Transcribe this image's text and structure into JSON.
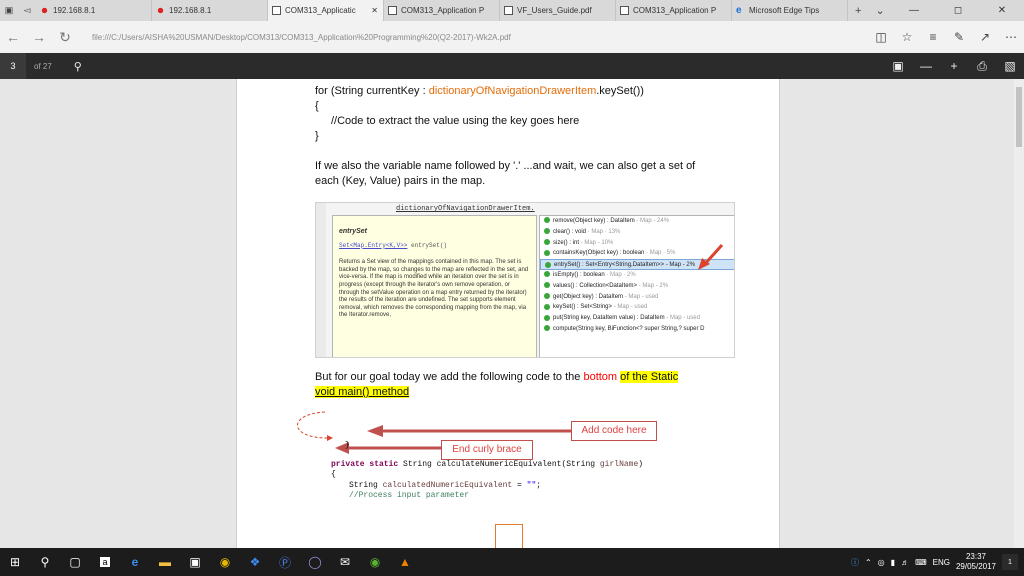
{
  "tabs": [
    {
      "label": "192.168.8.1",
      "active": false
    },
    {
      "label": "192.168.8.1",
      "active": false
    },
    {
      "label": "COM313_Applicatic",
      "active": true
    },
    {
      "label": "COM313_Application P",
      "active": false
    },
    {
      "label": "VF_Users_Guide.pdf",
      "active": false
    },
    {
      "label": "COM313_Application P",
      "active": false
    },
    {
      "label": "Microsoft Edge Tips",
      "active": false
    }
  ],
  "address": {
    "url": "file:///C:/Users/AISHA%20USMAN/Desktop/COM313/COM313_Application%20Programming%20(Q2-2017)-Wk2A.pdf"
  },
  "pdf_toolbar": {
    "page": "3",
    "of_total": "of 27"
  },
  "doc": {
    "line1_a": "for (String currentKey : ",
    "line1_b": "dictionaryOfNavigationDrawerItem",
    "line1_c": ".keySet())",
    "brace_open": "{",
    "comment": "//Code to extract the value using the key goes here",
    "brace_close": "}",
    "para1": "If we also the variable name followed by '.' ...and wait, we can also get a set of",
    "para2": "each (Key, Value) pairs in the map.",
    "para3_a": "But for our goal today we add the following code to the ",
    "para3_b": "bottom",
    "para3_c": "of the Static",
    "para3_d": "void main() method"
  },
  "eclipse": {
    "title": "dictionaryOfNavigationDrawerItem.",
    "jd_title": "entrySet",
    "jd_sig_a": "Set<Map.Entry<K,V>>",
    "jd_sig_b": " entrySet()",
    "jd_body": "Returns a Set view of the mappings contained in this map. The set is backed by the map, so changes to the map are reflected in the set, and vice-versa. If the map is modified while an iteration over the set is in progress (except through the iterator's own remove operation, or through the setValue operation on a map entry returned by the iterator) the results of the iteration are undefined. The set supports element removal, which removes the corresponding mapping from the map, via the Iterator.remove,",
    "proposals": [
      {
        "name": "remove(Object key) : DataItem",
        "pct": " - Map - 24%"
      },
      {
        "name": "clear() : void",
        "pct": " · Map · 13%"
      },
      {
        "name": "size() : int",
        "pct": " - Map - 10%"
      },
      {
        "name": "containsKey(Object key) : boolean",
        "pct": " · Map · 5%"
      },
      {
        "name": "entrySet() : Set<Entry<String,DataItem>> - Map - 2%",
        "pct": ""
      },
      {
        "name": "isEmpty() : boolean",
        "pct": " · Map · 2%"
      },
      {
        "name": "values() : Collection<DataItem>",
        "pct": " - Map - 2%"
      },
      {
        "name": "get(Object key) : DataItem",
        "pct": " - Map - used"
      },
      {
        "name": "keySet() : Set<String>",
        "pct": " - Map - used"
      },
      {
        "name": "put(String key, DataItem value) : DataItem",
        "pct": " - Map - used"
      },
      {
        "name": "compute(String key, BiFunction<? super String,? super D",
        "pct": ""
      }
    ]
  },
  "callouts": {
    "add_code": "Add code here",
    "end_brace": "End curly brace"
  },
  "code": {
    "brace": "}",
    "sig_kw": "private static ",
    "sig_type": "String ",
    "sig_name": "calculateNumericEquivalent",
    "sig_param_type": "(String ",
    "sig_param": "girlName",
    "sig_end": ")",
    "open": "{",
    "decl_type": "String ",
    "decl_var": "calculatedNumericEquivalent",
    "decl_eq": " = ",
    "decl_val": "\"\"",
    "decl_end": ";",
    "comment": "//Process input parameter"
  },
  "taskbar": {
    "lang": "ENG",
    "time": "23:37",
    "date": "29/05/2017",
    "notif": "1"
  }
}
